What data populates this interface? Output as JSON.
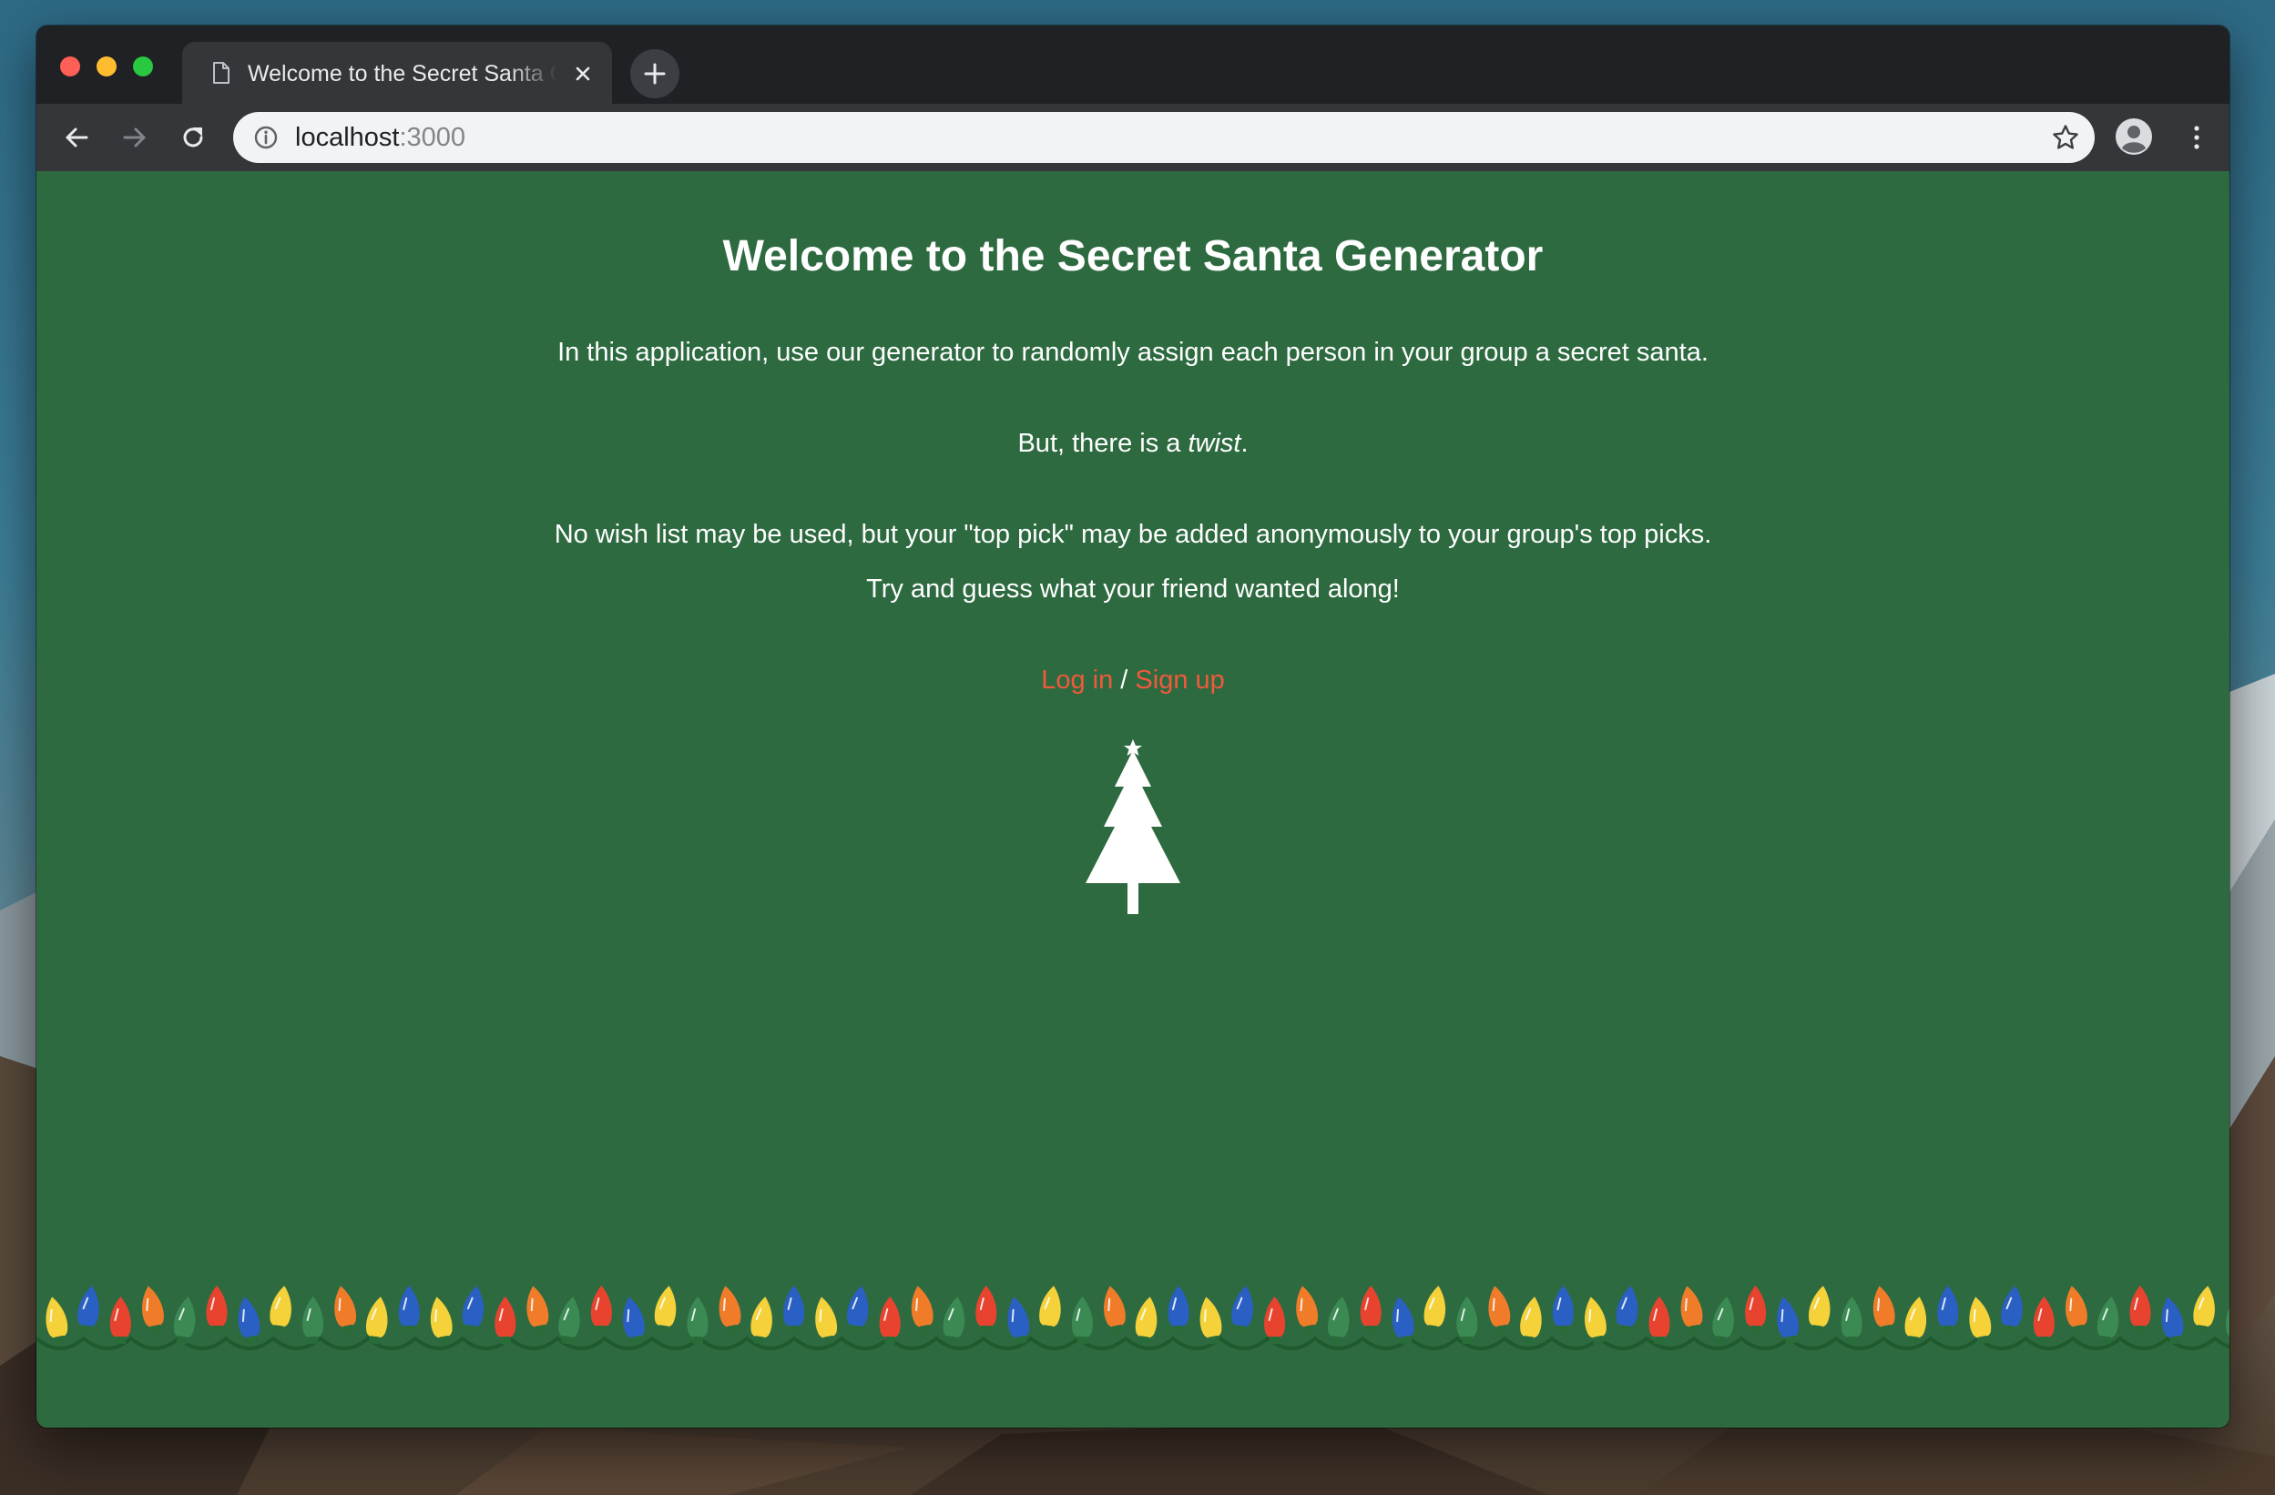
{
  "browser": {
    "tab_title": "Welcome to the Secret Santa Generator",
    "url_host": "localhost",
    "url_port": ":3000"
  },
  "page": {
    "title": "Welcome to the Secret Santa Generator",
    "intro": "In this application, use our generator to randomly assign each person in your group a secret santa.",
    "twist_prefix": "But, there is a ",
    "twist_word": "twist",
    "twist_suffix": ".",
    "rule": "No wish list may be used, but your \"top pick\" may be added anonymously to your group's top picks.",
    "challenge": "Try and guess what your friend wanted along!",
    "login_label": "Log in",
    "separator": " / ",
    "signup_label": "Sign up"
  },
  "icons": {
    "tab": "document-icon",
    "close": "close-icon",
    "new_tab": "plus-icon",
    "back": "back-arrow-icon",
    "forward": "forward-arrow-icon",
    "reload": "reload-icon",
    "site_info": "info-icon",
    "bookmark": "star-icon",
    "profile": "avatar-icon",
    "menu": "more-vertical-icon",
    "illustration": "christmas-tree-icon",
    "decoration": "christmas-lights"
  },
  "colors": {
    "page_background": "#2d6a40",
    "link": "#f05a3c",
    "text": "#ffffff",
    "bulbs": [
      "#e8432e",
      "#f07c2a",
      "#f5d13a",
      "#2a5fc4",
      "#3b8a54"
    ]
  }
}
